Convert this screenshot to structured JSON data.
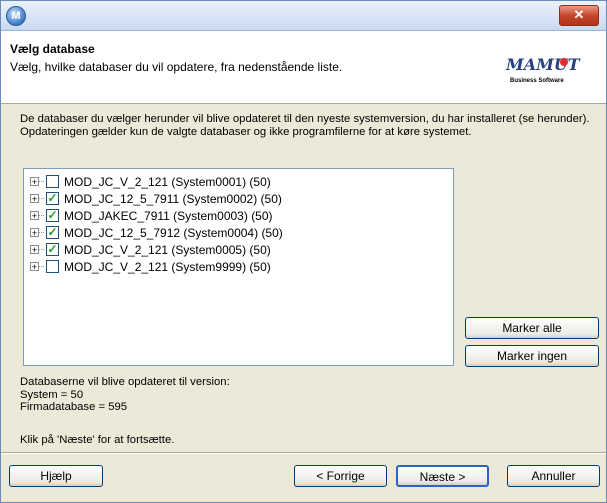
{
  "window": {
    "app_icon_glyph": "M"
  },
  "header": {
    "title": "Vælg database",
    "subtitle": "Vælg, hvilke databaser du vil opdatere, fra nedenstående liste.",
    "logo_text": "MAMUT",
    "logo_tagline": "Business Software"
  },
  "intro_text": "De databaser du vælger herunder vil blive opdateret til den nyeste systemversion, du har installeret (se herunder). Opdateringen gælder kun de valgte databaser og ikke programfilerne for at køre systemet.",
  "databases": [
    {
      "label": "MOD_JC_V_2_121 (System0001) (50)",
      "checked": false
    },
    {
      "label": "MOD_JC_12_5_7911 (System0002) (50)",
      "checked": true
    },
    {
      "label": "MOD_JAKEC_7911 (System0003) (50)",
      "checked": true
    },
    {
      "label": "MOD_JC_12_5_7912 (System0004) (50)",
      "checked": true
    },
    {
      "label": "MOD_JC_V_2_121 (System0005) (50)",
      "checked": true
    },
    {
      "label": "MOD_JC_V_2_121 (System9999) (50)",
      "checked": false
    }
  ],
  "buttons": {
    "select_all": "Marker alle",
    "select_none": "Marker ingen",
    "help": "Hjælp",
    "back": "< Forrige",
    "next": "Næste >",
    "cancel": "Annuller"
  },
  "version_info": {
    "heading": "Databaserne vil blive opdateret til version:",
    "system": "System = 50",
    "company_db": "Firmadatabase = 595"
  },
  "footer_note": "Klik på 'Næste' for at fortsætte.",
  "icons": {
    "close": "close-icon",
    "expand": "plus-expander-icon",
    "check": "checkmark-icon"
  }
}
